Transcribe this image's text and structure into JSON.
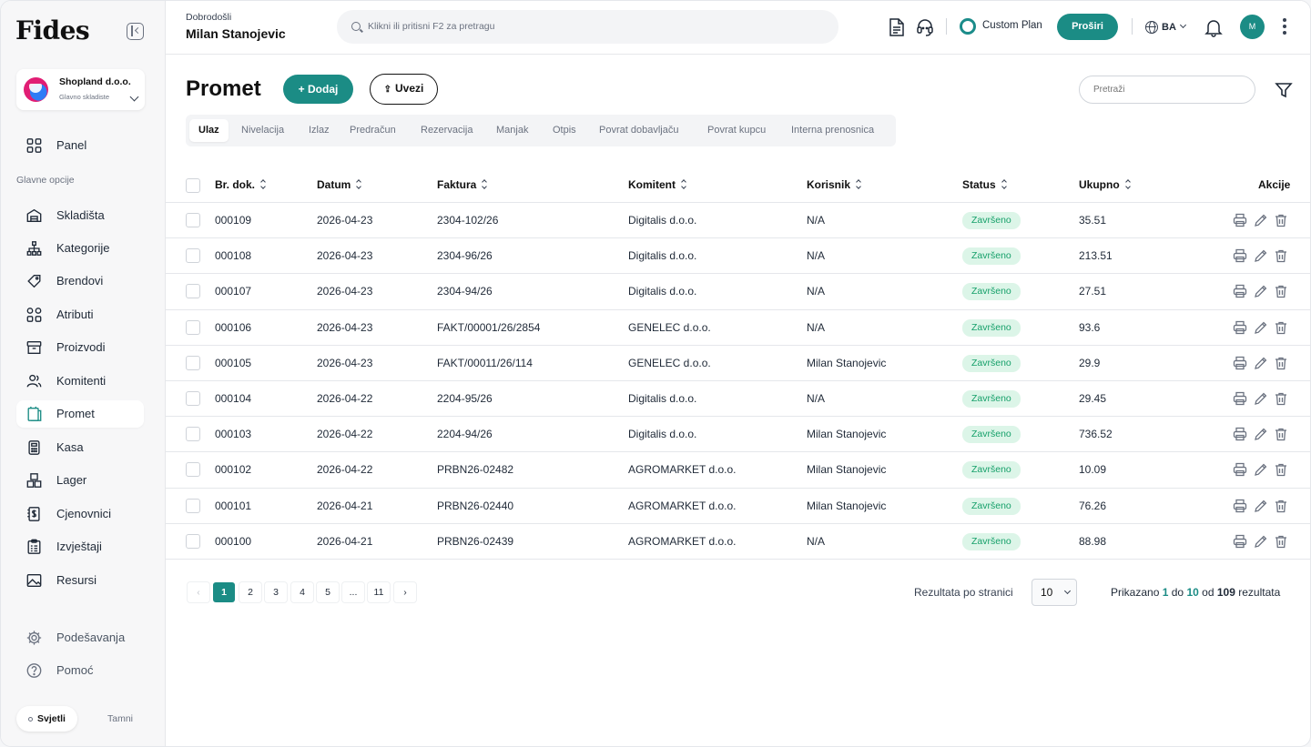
{
  "app": {
    "logo": "Fides"
  },
  "company": {
    "name": "Shopland d.o.o.",
    "warehouse": "Glavno skladiste"
  },
  "sidebar": {
    "top_item": "Panel",
    "section_label": "Glavne opcije",
    "items": [
      {
        "label": "Skladišta",
        "icon": "warehouse-icon"
      },
      {
        "label": "Kategorije",
        "icon": "hierarchy-icon"
      },
      {
        "label": "Brendovi",
        "icon": "tag-icon"
      },
      {
        "label": "Atributi",
        "icon": "attributes-icon"
      },
      {
        "label": "Proizvodi",
        "icon": "box-icon"
      },
      {
        "label": "Komitenti",
        "icon": "users-icon"
      },
      {
        "label": "Promet",
        "icon": "transactions-icon",
        "active": true
      },
      {
        "label": "Kasa",
        "icon": "cash-register-icon"
      },
      {
        "label": "Lager",
        "icon": "stock-icon"
      },
      {
        "label": "Cjenovnici",
        "icon": "price-list-icon"
      },
      {
        "label": "Izvještaji",
        "icon": "report-icon"
      },
      {
        "label": "Resursi",
        "icon": "image-icon"
      }
    ],
    "settings": "Podešavanja",
    "help": "Pomoć",
    "theme_light": "Svjetli",
    "theme_dark": "Tamni"
  },
  "header": {
    "welcome": "Dobrodošli",
    "user": "Milan Stanojevic",
    "search_placeholder": "Klikni ili pritisni F2 za pretragu",
    "plan": "Custom Plan",
    "upgrade": "Proširi",
    "language": "BA",
    "avatar_initial": "M"
  },
  "page": {
    "title": "Promet",
    "add_label": "+ Dodaj",
    "import_label": "Uvezi",
    "search_placeholder": "Pretraži",
    "tabs": [
      "Ulaz",
      "Nivelacija",
      "Izlaz",
      "Predračun",
      "Rezervacija",
      "Manjak",
      "Otpis",
      "Povrat dobavljaču",
      "Povrat kupcu",
      "Interna prenosnica"
    ],
    "active_tab": "Ulaz"
  },
  "table": {
    "headers": {
      "doc": "Br. dok.",
      "date": "Datum",
      "invoice": "Faktura",
      "client": "Komitent",
      "user": "Korisnik",
      "status": "Status",
      "total": "Ukupno",
      "actions": "Akcije"
    },
    "rows": [
      {
        "doc": "000109",
        "date": "2026-04-23",
        "invoice": "2304-102/26",
        "client": "Digitalis d.o.o.",
        "user": "N/A",
        "status": "Završeno",
        "total": "35.51"
      },
      {
        "doc": "000108",
        "date": "2026-04-23",
        "invoice": "2304-96/26",
        "client": "Digitalis d.o.o.",
        "user": "N/A",
        "status": "Završeno",
        "total": "213.51"
      },
      {
        "doc": "000107",
        "date": "2026-04-23",
        "invoice": "2304-94/26",
        "client": "Digitalis d.o.o.",
        "user": "N/A",
        "status": "Završeno",
        "total": "27.51"
      },
      {
        "doc": "000106",
        "date": "2026-04-23",
        "invoice": "FAKT/00001/26/2854",
        "client": "GENELEC d.o.o.",
        "user": "N/A",
        "status": "Završeno",
        "total": "93.6"
      },
      {
        "doc": "000105",
        "date": "2026-04-23",
        "invoice": "FAKT/00011/26/114",
        "client": "GENELEC d.o.o.",
        "user": "Milan Stanojevic",
        "status": "Završeno",
        "total": "29.9"
      },
      {
        "doc": "000104",
        "date": "2026-04-22",
        "invoice": "2204-95/26",
        "client": "Digitalis d.o.o.",
        "user": "N/A",
        "status": "Završeno",
        "total": "29.45"
      },
      {
        "doc": "000103",
        "date": "2026-04-22",
        "invoice": "2204-94/26",
        "client": "Digitalis d.o.o.",
        "user": "Milan Stanojevic",
        "status": "Završeno",
        "total": "736.52"
      },
      {
        "doc": "000102",
        "date": "2026-04-22",
        "invoice": "PRBN26-02482",
        "client": "AGROMARKET d.o.o.",
        "user": "Milan Stanojevic",
        "status": "Završeno",
        "total": "10.09"
      },
      {
        "doc": "000101",
        "date": "2026-04-21",
        "invoice": "PRBN26-02440",
        "client": "AGROMARKET d.o.o.",
        "user": "Milan Stanojevic",
        "status": "Završeno",
        "total": "76.26"
      },
      {
        "doc": "000100",
        "date": "2026-04-21",
        "invoice": "PRBN26-02439",
        "client": "AGROMARKET d.o.o.",
        "user": "N/A",
        "status": "Završeno",
        "total": "88.98"
      }
    ]
  },
  "pagination": {
    "prev": "‹",
    "next": "›",
    "pages": [
      "1",
      "2",
      "3",
      "4",
      "5",
      "...",
      "11"
    ],
    "current": "1",
    "per_page_label": "Rezultata po stranici",
    "per_page": "10",
    "summary_prefix": "Prikazano",
    "from": "1",
    "to_word": "do",
    "to": "10",
    "of_word": "od",
    "total": "109",
    "suffix": "rezultata"
  },
  "colors": {
    "accent": "#1b8c85",
    "status_bg": "#dcf5e8",
    "status_text": "#16a06a"
  }
}
